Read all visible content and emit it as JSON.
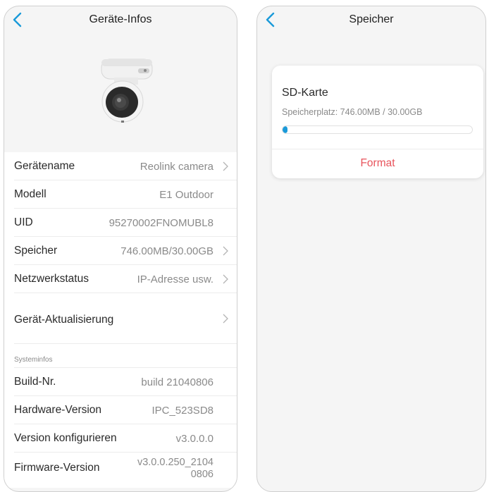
{
  "colors": {
    "accent": "#1a9ad9",
    "danger": "#e8545c",
    "muted": "#8a8a8a"
  },
  "left_screen": {
    "title": "Geräte-Infos",
    "back_icon": "chevron-left-icon",
    "device_image": "camera-icon",
    "rows": [
      {
        "label": "Gerätename",
        "value": "Reolink camera",
        "chevron": true
      },
      {
        "label": "Modell",
        "value": "E1 Outdoor",
        "chevron": false
      },
      {
        "label": "UID",
        "value": "95270002FNOMUBL8",
        "chevron": false
      },
      {
        "label": "Speicher",
        "value": "746.00MB/30.00GB",
        "chevron": true
      },
      {
        "label": "Netzwerkstatus",
        "value": "IP-Adresse usw.",
        "chevron": true
      }
    ],
    "update_label": "Gerät-Aktualisierung",
    "system_section_label": "Systeminfos",
    "system_rows": [
      {
        "label": "Build-Nr.",
        "value": "build 21040806"
      },
      {
        "label": "Hardware-Version",
        "value": "IPC_523SD8"
      },
      {
        "label": "Version konfigurieren",
        "value": "v3.0.0.0"
      }
    ],
    "firmware": {
      "label": "Firmware-Version",
      "value_line1": "v3.0.0.250_2104",
      "value_line2": "0806"
    }
  },
  "right_screen": {
    "title": "Speicher",
    "back_icon": "chevron-left-icon",
    "sd_card": {
      "title": "SD-Karte",
      "usage_label": "Speicherplatz: 746.00MB / 30.00GB",
      "used_fraction": 0.0243,
      "format_label": "Format"
    }
  }
}
